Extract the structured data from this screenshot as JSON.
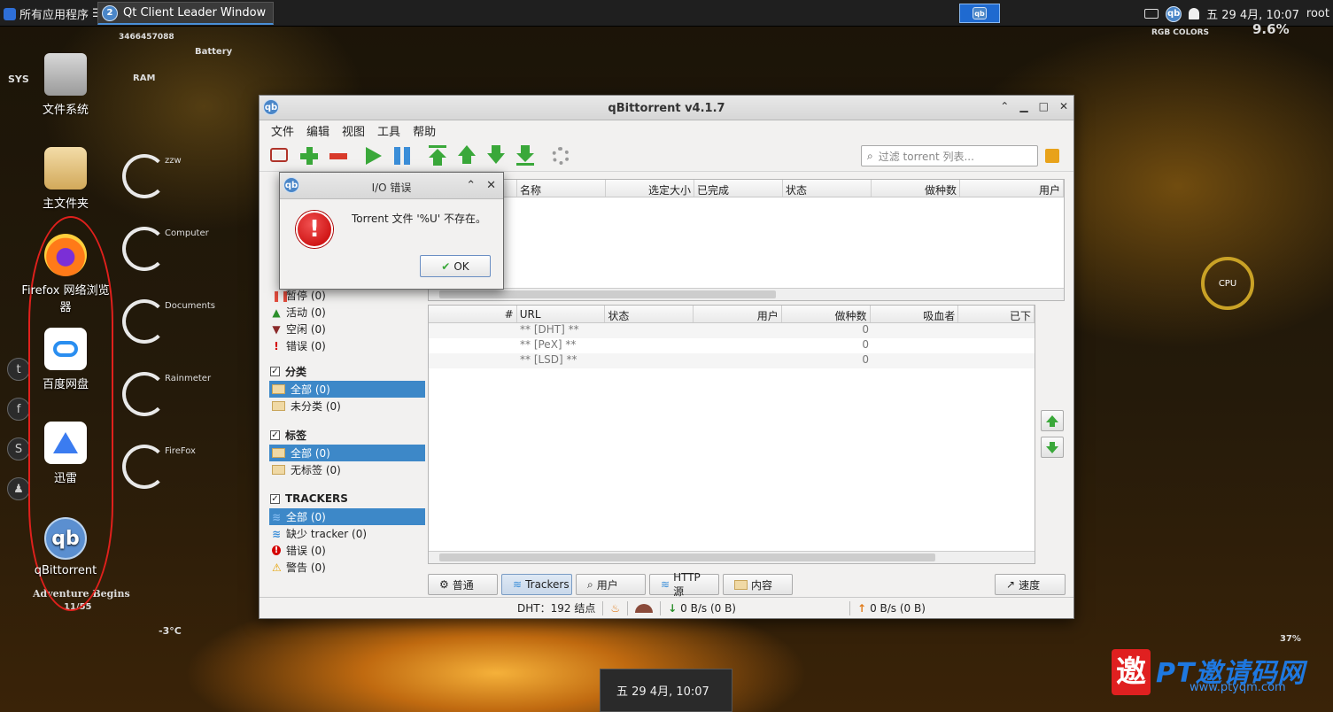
{
  "taskbar": {
    "start_label": "所有应用程序",
    "start_sep": "☰",
    "task_title": "Qt Client Leader Window",
    "task_badge": "2",
    "clock": "五 29 4月, 10:07",
    "user": "root"
  },
  "desktop": {
    "icons": [
      {
        "label": "文件系统",
        "icon": "drive-icon"
      },
      {
        "label": "主文件夹",
        "icon": "home-folder-icon"
      },
      {
        "label": "Firefox 网络浏览器",
        "icon": "firefox-icon"
      },
      {
        "label": "百度网盘",
        "icon": "baidu-netdisk-icon"
      },
      {
        "label": "迅雷",
        "icon": "xunlei-icon"
      },
      {
        "label": "qBittorrent",
        "icon": "qbittorrent-icon"
      }
    ],
    "gauges": [
      "zzw",
      "Computer",
      "Documents",
      "Rainmeter",
      "FireFox"
    ],
    "hud": {
      "number": "3466457088",
      "battery": "Battery",
      "sys": "SYS",
      "ram": "RAM",
      "rgb": "RGB COLORS",
      "pct_top": "9.6%",
      "cpu": "CPU",
      "temp": "-3°C",
      "adventure": "Adventure Begins",
      "page": "11/55",
      "pct_bottom": "37%"
    },
    "clock_popup": "五 29 4月, 10:07",
    "watermark": {
      "badge": "邀",
      "text": "PT邀请码网",
      "url": "www.ptyqm.com"
    }
  },
  "window": {
    "title": "qBittorrent v4.1.7",
    "menu": [
      "文件",
      "编辑",
      "视图",
      "工具",
      "帮助"
    ],
    "search_placeholder": "过滤 torrent 列表...",
    "side": {
      "status_rows": [
        {
          "label": "暂停 (0)",
          "mark": "❚❚",
          "color": "#e24b3c"
        },
        {
          "label": "活动 (0)",
          "mark": "▲",
          "color": "#2c8f2c"
        },
        {
          "label": "空闲 (0)",
          "mark": "▼",
          "color": "#8b2a2a"
        },
        {
          "label": "错误 (0)",
          "mark": "!",
          "color": "#d40000"
        }
      ],
      "category_header": "分类",
      "categories": [
        "全部 (0)",
        "未分类 (0)"
      ],
      "tags_header": "标签",
      "tags": [
        "全部 (0)",
        "无标签 (0)"
      ],
      "trackers_header": "TRACKERS",
      "trackers": [
        {
          "label": "全部 (0)",
          "mark": "≋"
        },
        {
          "label": "缺少 tracker (0)",
          "mark": "≋"
        },
        {
          "label": "错误 (0)",
          "mark": "!"
        },
        {
          "label": "警告 (0)",
          "mark": "⚠"
        }
      ]
    },
    "torrent_columns": [
      "名称",
      "选定大小",
      "已完成",
      "状态",
      "做种数",
      "用户"
    ],
    "tracker_columns": [
      "#",
      "URL",
      "状态",
      "用户",
      "做种数",
      "吸血者",
      "已下"
    ],
    "tracker_rows": [
      {
        "url": "** [DHT] **",
        "peers": "0"
      },
      {
        "url": "** [PeX] **",
        "peers": "0"
      },
      {
        "url": "** [LSD] **",
        "peers": "0"
      }
    ],
    "tabs": [
      "普通",
      "Trackers",
      "用户",
      "HTTP 源",
      "内容"
    ],
    "speed_tab": "速度",
    "status": {
      "dht": "DHT：192 结点",
      "down": "0 B/s (0 B)",
      "up": "0 B/s (0 B)"
    }
  },
  "dialog": {
    "title": "I/O 错误",
    "message": "Torrent 文件 '%U' 不存在。",
    "ok": "OK"
  }
}
